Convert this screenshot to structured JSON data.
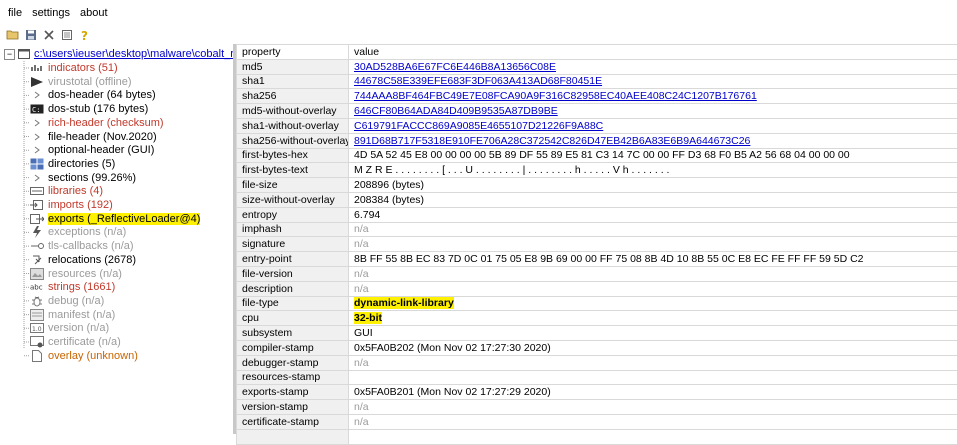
{
  "menu": {
    "file": "file",
    "settings": "settings",
    "about": "about"
  },
  "toolbar": {
    "icons": [
      "open-icon",
      "save-icon",
      "close-icon",
      "list-icon",
      "help-icon"
    ]
  },
  "tree": {
    "root": "c:\\users\\ieuser\\desktop\\malware\\cobalt_reflecti",
    "items": [
      {
        "label": "indicators (51)",
        "style": "red",
        "icon": "indicators-icon"
      },
      {
        "label": "virustotal (offline)",
        "style": "gray",
        "icon": "virustotal-icon"
      },
      {
        "label": "dos-header (64 bytes)",
        "style": "default",
        "icon": "arrow-icon"
      },
      {
        "label": "dos-stub (176 bytes)",
        "style": "default",
        "icon": "dos-stub-icon"
      },
      {
        "label": "rich-header (checksum)",
        "style": "red",
        "icon": "arrow-icon"
      },
      {
        "label": "file-header (Nov.2020)",
        "style": "default",
        "icon": "arrow-icon"
      },
      {
        "label": "optional-header (GUI)",
        "style": "default",
        "icon": "arrow-icon"
      },
      {
        "label": "directories (5)",
        "style": "default",
        "icon": "directories-icon"
      },
      {
        "label": "sections (99.26%)",
        "style": "default",
        "icon": "arrow-icon"
      },
      {
        "label": "libraries (4)",
        "style": "red",
        "icon": "libraries-icon"
      },
      {
        "label": "imports (192)",
        "style": "red",
        "icon": "imports-icon"
      },
      {
        "label": "exports (_ReflectiveLoader@4)",
        "style": "default",
        "icon": "exports-icon",
        "highlight": true
      },
      {
        "label": "exceptions (n/a)",
        "style": "gray",
        "icon": "exceptions-icon"
      },
      {
        "label": "tls-callbacks (n/a)",
        "style": "gray",
        "icon": "tls-icon"
      },
      {
        "label": "relocations (2678)",
        "style": "default",
        "icon": "relocations-icon"
      },
      {
        "label": "resources (n/a)",
        "style": "gray",
        "icon": "resources-icon"
      },
      {
        "label": "strings (1661)",
        "style": "red",
        "icon": "strings-icon"
      },
      {
        "label": "debug (n/a)",
        "style": "gray",
        "icon": "debug-icon"
      },
      {
        "label": "manifest (n/a)",
        "style": "gray",
        "icon": "manifest-icon"
      },
      {
        "label": "version (n/a)",
        "style": "gray",
        "icon": "version-icon"
      },
      {
        "label": "certificate (n/a)",
        "style": "gray",
        "icon": "certificate-icon"
      },
      {
        "label": "overlay (unknown)",
        "style": "orange",
        "icon": "overlay-icon"
      }
    ]
  },
  "table": {
    "headers": [
      "property",
      "value"
    ],
    "rows": [
      {
        "property": "md5",
        "value": "30AD528BA6E67FC6E446B8A13656C08E",
        "style": "link"
      },
      {
        "property": "sha1",
        "value": "44678C58E339EFE683F3DF063A413AD68F80451E",
        "style": "link"
      },
      {
        "property": "sha256",
        "value": "744AAA8BF464FBC49E7E08FCA90A9F316C82958EC40AEE408C24C1207B176761",
        "style": "link"
      },
      {
        "property": "md5-without-overlay",
        "value": "646CF80B64ADA84D409B9535A87DB9BE",
        "style": "link"
      },
      {
        "property": "sha1-without-overlay",
        "value": "C619791FACCC869A9085E4655107D21226F9A88C",
        "style": "link"
      },
      {
        "property": "sha256-without-overlay",
        "value": "891D68B717F5318E910FE706A28C372542C826D47EB42B6A83E6B9A644673C26",
        "style": "link"
      },
      {
        "property": "first-bytes-hex",
        "value": "4D 5A 52 45 E8 00 00 00 00 5B 89 DF 55 89 E5 81 C3 14 7C 00 00 FF D3 68 F0 B5 A2 56 68 04 00 00 00",
        "style": "normal"
      },
      {
        "property": "first-bytes-text",
        "value": "M Z R E . . . . . . . . [ . . . U . . . . . . . . | . . . . . . . . h . . . . . V h . . . . . . .",
        "style": "normal"
      },
      {
        "property": "file-size",
        "value": "208896 (bytes)",
        "style": "normal"
      },
      {
        "property": "size-without-overlay",
        "value": "208384 (bytes)",
        "style": "normal"
      },
      {
        "property": "entropy",
        "value": "6.794",
        "style": "normal"
      },
      {
        "property": "imphash",
        "value": "n/a",
        "style": "na"
      },
      {
        "property": "signature",
        "value": "n/a",
        "style": "na"
      },
      {
        "property": "entry-point",
        "value": "8B FF 55 8B EC 83 7D 0C 01 75 05 E8 9B 69 00 00 FF 75 08 8B 4D 10 8B 55 0C E8 EC FE FF FF 59 5D C2",
        "style": "normal"
      },
      {
        "property": "file-version",
        "value": "n/a",
        "style": "na"
      },
      {
        "property": "description",
        "value": "n/a",
        "style": "na"
      },
      {
        "property": "file-type",
        "value": "dynamic-link-library",
        "style": "highlight"
      },
      {
        "property": "cpu",
        "value": "32-bit",
        "style": "highlight"
      },
      {
        "property": "subsystem",
        "value": "GUI",
        "style": "normal"
      },
      {
        "property": "compiler-stamp",
        "value": "0x5FA0B202 (Mon Nov 02 17:27:30 2020)",
        "style": "normal"
      },
      {
        "property": "debugger-stamp",
        "value": "n/a",
        "style": "na"
      },
      {
        "property": "resources-stamp",
        "value": "",
        "style": "normal"
      },
      {
        "property": "exports-stamp",
        "value": "0x5FA0B201 (Mon Nov 02 17:27:29 2020)",
        "style": "normal"
      },
      {
        "property": "version-stamp",
        "value": "n/a",
        "style": "na"
      },
      {
        "property": "certificate-stamp",
        "value": "n/a",
        "style": "na"
      },
      {
        "property": "",
        "value": "",
        "style": "normal"
      }
    ]
  },
  "colors": {
    "link": "#0000cc",
    "highlight": "#fff100",
    "red_label": "#c0392b",
    "gray_label": "#9b9b9b",
    "orange_label": "#c86400"
  }
}
